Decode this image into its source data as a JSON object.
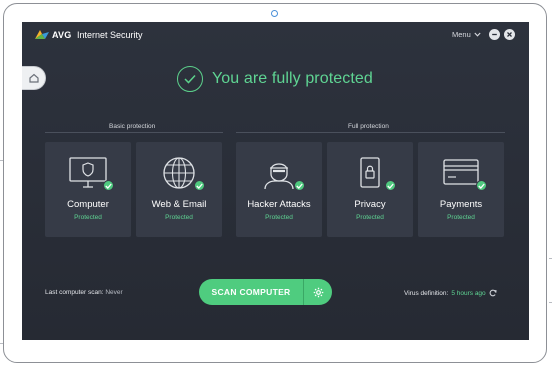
{
  "app": {
    "brand": "AVG",
    "product": "Internet Security",
    "menu_label": "Menu"
  },
  "status": {
    "text": "You are fully protected"
  },
  "sections": {
    "basic": "Basic protection",
    "full": "Full protection"
  },
  "cards": [
    {
      "name": "Computer",
      "state": "Protected",
      "icon": "monitor-shield-icon"
    },
    {
      "name": "Web & Email",
      "state": "Protected",
      "icon": "globe-icon"
    },
    {
      "name": "Hacker Attacks",
      "state": "Protected",
      "icon": "hacker-icon"
    },
    {
      "name": "Privacy",
      "state": "Protected",
      "icon": "lock-icon"
    },
    {
      "name": "Payments",
      "state": "Protected",
      "icon": "credit-card-icon"
    }
  ],
  "footer": {
    "last_scan_label": "Last computer scan:",
    "last_scan_value": "Never",
    "scan_button": "SCAN COMPUTER",
    "virus_def_label": "Virus definition:",
    "virus_def_value": "5 hours ago"
  },
  "colors": {
    "accent_green": "#4fcc7f",
    "app_background": "#2b303a",
    "card_background": "#363b47"
  }
}
